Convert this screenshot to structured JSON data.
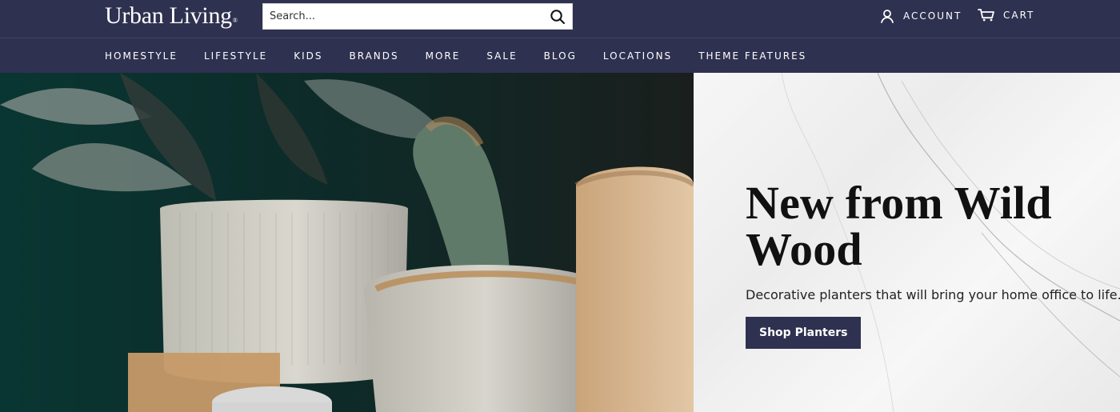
{
  "header": {
    "logo": "Urban Living",
    "logo_mark": "®",
    "search_placeholder": "Search...",
    "account_label": "ACCOUNT",
    "cart_label": "CART",
    "colors": {
      "brand": "#2f3150",
      "text": "#ffffff"
    }
  },
  "nav": {
    "items": [
      {
        "label": "HOMESTYLE"
      },
      {
        "label": "LIFESTYLE"
      },
      {
        "label": "KIDS"
      },
      {
        "label": "BRANDS"
      },
      {
        "label": "MORE"
      },
      {
        "label": "SALE"
      },
      {
        "label": "BLOG"
      },
      {
        "label": "LOCATIONS"
      },
      {
        "label": "THEME FEATURES"
      }
    ]
  },
  "hero": {
    "title": "New from Wild Wood",
    "subtitle": "Decorative planters that will bring your home office to life.",
    "button_label": "Shop Planters",
    "icons": [
      "search-icon",
      "account-icon",
      "cart-icon"
    ]
  }
}
